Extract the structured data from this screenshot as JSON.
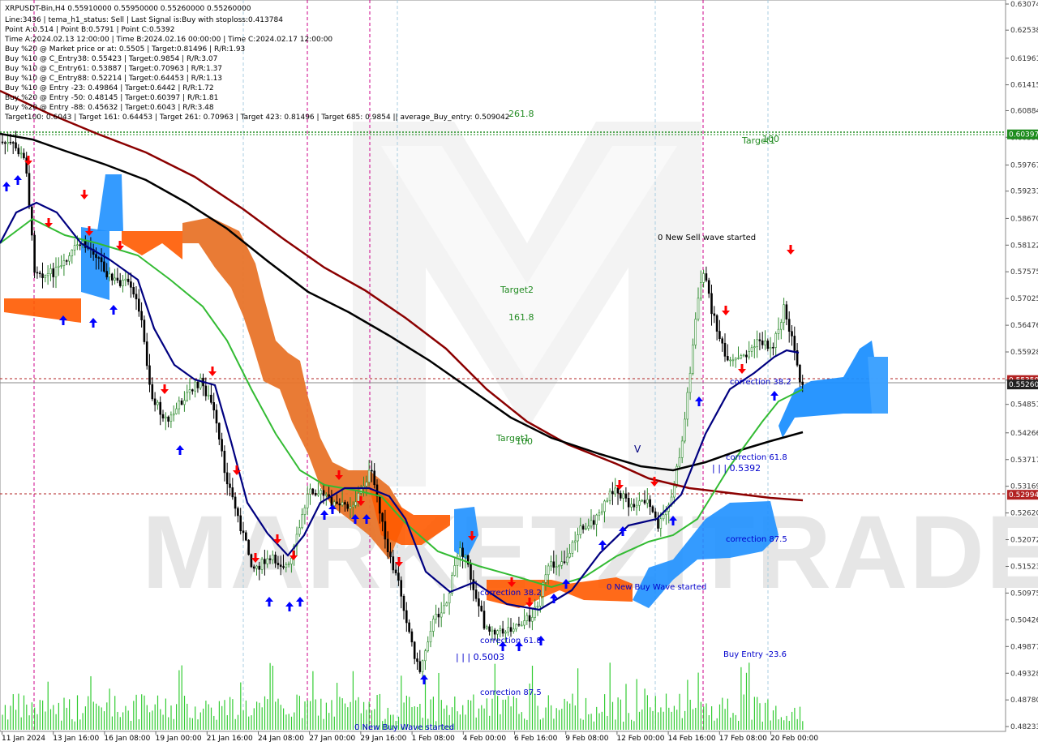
{
  "chart_data": {
    "type": "candlestick",
    "symbol_line": "XRPUSDT-Bin,H4  0.55910000 0.55950000 0.55260000 0.55260000",
    "info_lines": [
      "Line:3436 | tema_h1_status: Sell | Last Signal is:Buy with stoploss:0.413784",
      "Point A:0.514 | Point B:0.5791 | Point C:0.5392",
      "Time A:2024.02.13 12:00:00 | Time B:2024.02.16 00:00:00 | Time C:2024.02.17 12:00:00",
      "Buy %20 @ Market price or at: 0.5505 | Target:0.81496 | R/R:1.93",
      "Buy %10 @ C_Entry38: 0.55423 | Target:0.9854 | R/R:3.07",
      "Buy %10 @ C_Entry61: 0.53887 | Target:0.70963 | R/R:1.37",
      "Buy %10 @ C_Entry88: 0.52214 | Target:0.64453 | R/R:1.13",
      "Buy %10 @ Entry -23: 0.49864 | Target:0.6442 | R/R:1.72",
      "Buy %20 @ Entry -50: 0.48145 | Target:0.60397 | R/R:1.81",
      "Buy %20 @ Entry -88: 0.45632 | Target:0.6043 | R/R:3.48",
      "Target100: 0.6043 | Target 161: 0.64453 | Target 261: 0.70963 | Target 423: 0.81496 | Target 685: 0.9854 || average_Buy_entry: 0.509042"
    ],
    "y_axis": {
      "min": 0.48233,
      "max": 0.63074,
      "ticks": [
        "0.63074",
        "0.62538",
        "0.61961",
        "0.61415",
        "0.60884",
        "0.60338",
        "0.59767",
        "0.59231",
        "0.58670",
        "0.58122",
        "0.57575",
        "0.57025",
        "0.56476",
        "0.55928",
        "0.55350",
        "0.54851",
        "0.54266",
        "0.53717",
        "0.53169",
        "0.52620",
        "0.52072",
        "0.51523",
        "0.50975",
        "0.50426",
        "0.49877",
        "0.49328",
        "0.48780",
        "0.48233"
      ]
    },
    "x_axis": {
      "ticks": [
        "11 Jan 2024",
        "13 Jan 16:00",
        "16 Jan 08:00",
        "19 Jan 00:00",
        "21 Jan 16:00",
        "24 Jan 08:00",
        "27 Jan 00:00",
        "29 Jan 16:00",
        "1 Feb 08:00",
        "4 Feb 00:00",
        "6 Feb 16:00",
        "9 Feb 08:00",
        "12 Feb 00:00",
        "14 Feb 16:00",
        "17 Feb 08:00",
        "20 Feb 00:00"
      ]
    },
    "price_tags": [
      {
        "label": "0.60397",
        "value": 0.60397,
        "color": "#1e8c1e"
      },
      {
        "label": "0.55350",
        "value": 0.5535,
        "color": "#b22222"
      },
      {
        "label": "0.55260",
        "value": 0.5526,
        "color": "#222222"
      },
      {
        "label": "0.52994",
        "value": 0.52994,
        "color": "#b22222"
      }
    ],
    "annotations": [
      {
        "text": "261.8",
        "color": "#228B22"
      },
      {
        "text": "Target1",
        "color": "#228B22"
      },
      {
        "text": "100",
        "color": "#228B22"
      },
      {
        "text": "Target2",
        "color": "#228B22"
      },
      {
        "text": "161.8",
        "color": "#228B22"
      },
      {
        "text": "Target1",
        "color": "#228B22"
      },
      {
        "text": "100",
        "color": "#228B22"
      },
      {
        "text": "0 New Sell wave started",
        "color": "#000000"
      },
      {
        "text": "correction 38.2",
        "color": "#0000cc"
      },
      {
        "text": "correction 61.8",
        "color": "#0000cc"
      },
      {
        "text": "| | | 0.5392",
        "color": "#0000cc"
      },
      {
        "text": "correction 87.5",
        "color": "#0000cc"
      },
      {
        "text": "0 New Buy Wave started",
        "color": "#0000cc"
      },
      {
        "text": "correction 38.2",
        "color": "#0000cc"
      },
      {
        "text": "correction 61.8",
        "color": "#0000cc"
      },
      {
        "text": "| | | 0.5003",
        "color": "#0000cc"
      },
      {
        "text": "correction 87.5",
        "color": "#0000cc"
      },
      {
        "text": "Buy Entry -23.6",
        "color": "#0000cc"
      },
      {
        "text": "0 New Buy Wave started",
        "color": "#0000cc"
      }
    ],
    "watermark": "MARKETZITRADE",
    "colors": {
      "bull_candle": "#2e8b2e",
      "bear_candle": "#000000",
      "volume": "#33cc33",
      "ma_navy": "#000080",
      "ma_green": "#33bb33",
      "ma_black": "#000000",
      "ma_darkred": "#8b0000",
      "cloud_orange": "#ff6a00",
      "cloud_blue": "#1e90ff",
      "target_line": "#1e8c1e",
      "level_red": "#b22222",
      "buy_arrow": "#0000ff",
      "sell_arrow": "#ff0000"
    }
  }
}
